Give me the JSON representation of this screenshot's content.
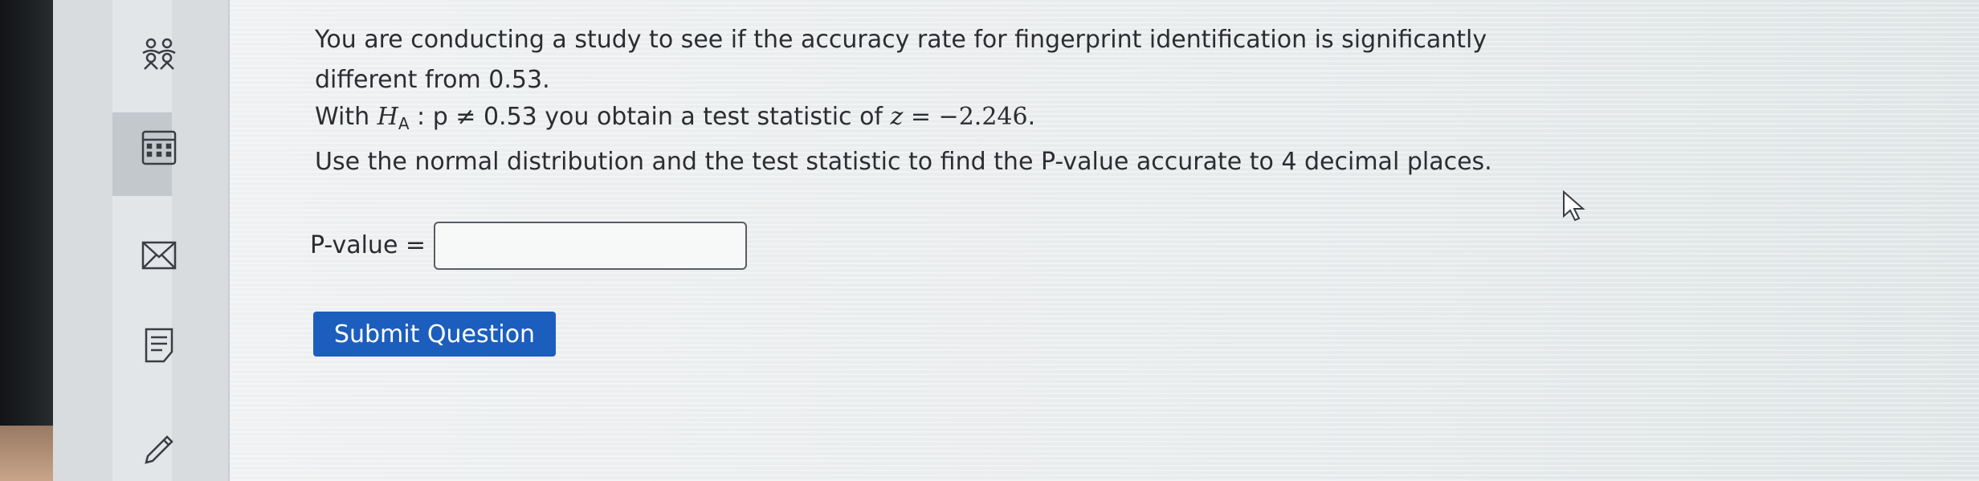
{
  "sidebar": {
    "icons": [
      "people-icon",
      "calculator-icon",
      "mail-icon",
      "document-icon",
      "pencil-icon"
    ]
  },
  "question": {
    "line1": "You are conducting a study to see if the accuracy rate for fingerprint identification is significantly",
    "line2": "different from 0.53.",
    "line3_prefix": "With ",
    "hyp_symbol": "H",
    "hyp_sub": "A",
    "hyp_rest": " : p ≠ 0.53",
    "line3_mid": " you obtain a test statistic of ",
    "stat_var": "z",
    "stat_eq": " = −2.246",
    "stat_end": ".",
    "line4": "Use the normal distribution and the test statistic to find the P-value accurate to 4 decimal places."
  },
  "answer": {
    "label": "P-value =",
    "value": "",
    "placeholder": ""
  },
  "submit_label": "Submit Question"
}
